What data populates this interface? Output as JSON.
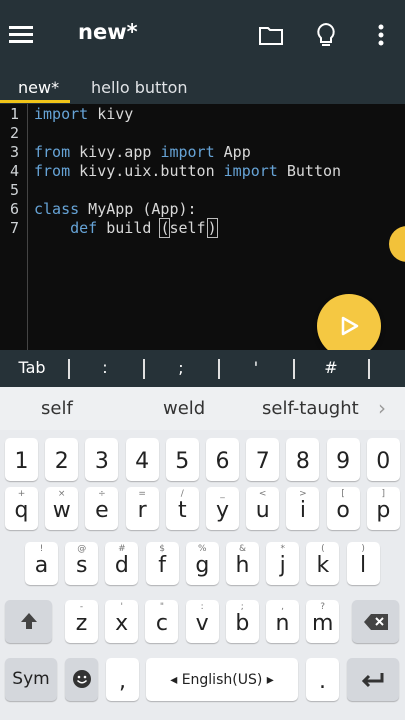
{
  "appbar": {
    "title": "new*",
    "menu_icon": "hamburger-menu-icon",
    "folder_icon": "folder-icon",
    "bulb_icon": "lightbulb-icon",
    "more_icon": "more-vert-icon"
  },
  "tabs": [
    {
      "label": "new*",
      "active": true
    },
    {
      "label": "hello button",
      "active": false
    }
  ],
  "editor": {
    "line_numbers": [
      "1",
      "2",
      "3",
      "4",
      "5",
      "6",
      "7"
    ],
    "lines": [
      [
        "import",
        " kivy"
      ],
      [],
      [
        "from",
        " kivy.app ",
        "import",
        " App"
      ],
      [
        "from",
        " kivy.uix.button ",
        "import",
        " Button"
      ],
      [],
      [
        "class",
        " MyApp (App):"
      ],
      [
        "    ",
        "def",
        " build ",
        "(",
        "self",
        ")"
      ]
    ]
  },
  "run_button": {
    "icon": "play-icon"
  },
  "symbol_bar": [
    "Tab",
    ":",
    ";",
    "'",
    "#"
  ],
  "suggestions": [
    "self",
    "weld",
    "self-taught"
  ],
  "keyboard": {
    "numbers": [
      "1",
      "2",
      "3",
      "4",
      "5",
      "6",
      "7",
      "8",
      "9",
      "0"
    ],
    "row1": [
      "q",
      "w",
      "e",
      "r",
      "t",
      "y",
      "u",
      "i",
      "o",
      "p"
    ],
    "row1_sup": [
      "+",
      "×",
      "÷",
      "=",
      "/",
      "_",
      "<",
      ">",
      "[",
      "]"
    ],
    "row2": [
      "a",
      "s",
      "d",
      "f",
      "g",
      "h",
      "j",
      "k",
      "l"
    ],
    "row2_sup": [
      "!",
      "@",
      "#",
      "$",
      "%",
      "&",
      "*",
      "(",
      ")"
    ],
    "row3": [
      "z",
      "x",
      "c",
      "v",
      "b",
      "n",
      "m"
    ],
    "row3_sup": [
      "-",
      "'",
      "\"",
      ":",
      ";",
      ",",
      "?"
    ],
    "sym_label": "Sym",
    "comma": ",",
    "comma_sup": "",
    "space_label": "English(US)",
    "period": ".",
    "shift_icon": "shift-up-arrow-icon",
    "backspace_icon": "backspace-icon",
    "emoji_icon": "emoji-icon",
    "enter_icon": "enter-icon"
  }
}
